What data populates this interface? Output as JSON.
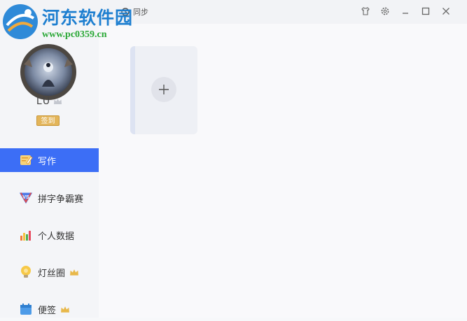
{
  "watermark": {
    "site_name": "河东软件园",
    "url": "www.pc0359.cn"
  },
  "titlebar": {
    "sync_label": "同步",
    "controls": [
      "shirt-icon",
      "settings-icon",
      "minimize-icon",
      "maximize-icon",
      "close-icon"
    ]
  },
  "profile": {
    "username": "LU",
    "checkin_label": "签到"
  },
  "sidebar": {
    "items": [
      {
        "label": "写作",
        "icon": "write-icon",
        "active": true,
        "crown": false
      },
      {
        "label": "拼字争霸赛",
        "icon": "vs-icon",
        "active": false,
        "crown": false
      },
      {
        "label": "个人数据",
        "icon": "bar-chart-icon",
        "active": false,
        "crown": false
      },
      {
        "label": "灯丝圈",
        "icon": "lightbulb-icon",
        "active": false,
        "crown": true
      },
      {
        "label": "便签",
        "icon": "note-icon",
        "active": false,
        "crown": true
      }
    ]
  },
  "colors": {
    "accent": "#3c6ef6",
    "crown": "#e8b84a",
    "checkin": "#e3b55a"
  }
}
